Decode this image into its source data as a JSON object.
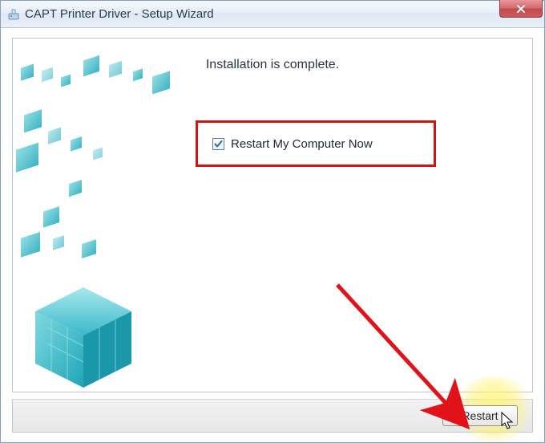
{
  "titlebar": {
    "title": "CAPT Printer Driver - Setup Wizard"
  },
  "content": {
    "complete_message": "Installation is complete.",
    "restart_checkbox_label": "Restart My Computer Now",
    "restart_checked": true
  },
  "buttons": {
    "restart_label": "Restart"
  },
  "icons": {
    "app": "installer-icon",
    "close": "close-icon",
    "check": "checkmark-icon",
    "cursor": "cursor-icon"
  },
  "annotations": {
    "highlight_color": "#fff178",
    "arrow_color": "#e2121a",
    "box_color": "#d11313"
  }
}
